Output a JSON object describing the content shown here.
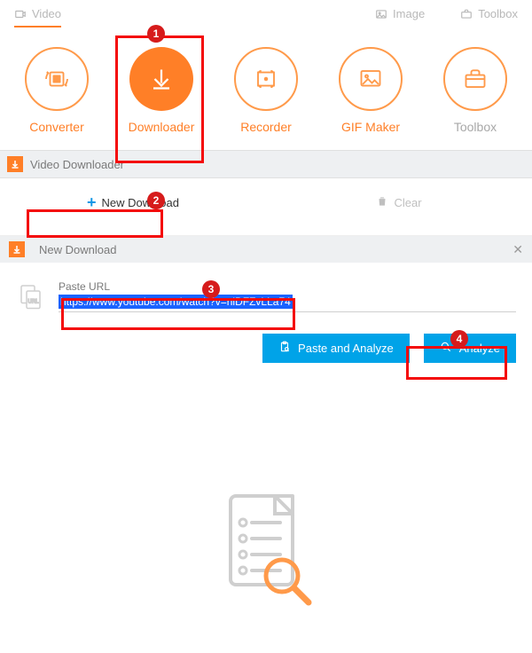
{
  "nav": {
    "video": "Video",
    "image": "Image",
    "toolbox": "Toolbox"
  },
  "tools": {
    "converter": "Converter",
    "downloader": "Downloader",
    "recorder": "Recorder",
    "gifmaker": "GIF Maker",
    "toolbox": "Toolbox"
  },
  "panel": {
    "title": "Video Downloader"
  },
  "actions": {
    "new_download": "New Download",
    "clear": "Clear"
  },
  "modal": {
    "title": "New Download",
    "paste_label": "Paste URL",
    "url_value": "https://www.youtube.com/watch?v=nlDFZvLLa74",
    "paste_analyze": "Paste and Analyze",
    "analyze": "Analyze"
  },
  "annotations": {
    "step1": "1",
    "step2": "2",
    "step3": "3",
    "step4": "4"
  }
}
